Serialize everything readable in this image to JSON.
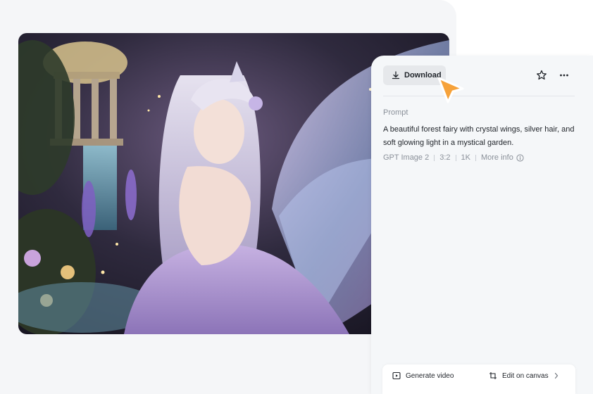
{
  "toolbar": {
    "download_label": "Download",
    "download_icon": "download-icon",
    "favorite_icon": "star-icon",
    "more_icon": "more-horizontal-icon"
  },
  "details": {
    "prompt_label": "Prompt",
    "prompt_text": "A beautiful forest fairy with crystal wings, silver hair, and soft glowing light in a mystical garden.",
    "meta": {
      "model": "GPT Image 2",
      "aspect_ratio": "3:2",
      "resolution": "1K",
      "more_info_label": "More info"
    }
  },
  "actions": {
    "generate_video_label": "Generate video",
    "edit_on_canvas_label": "Edit on canvas"
  },
  "colors": {
    "cursor": "#f6a23a",
    "panel_bg": "#f5f7f9",
    "button_bg": "#e6e8eb"
  }
}
